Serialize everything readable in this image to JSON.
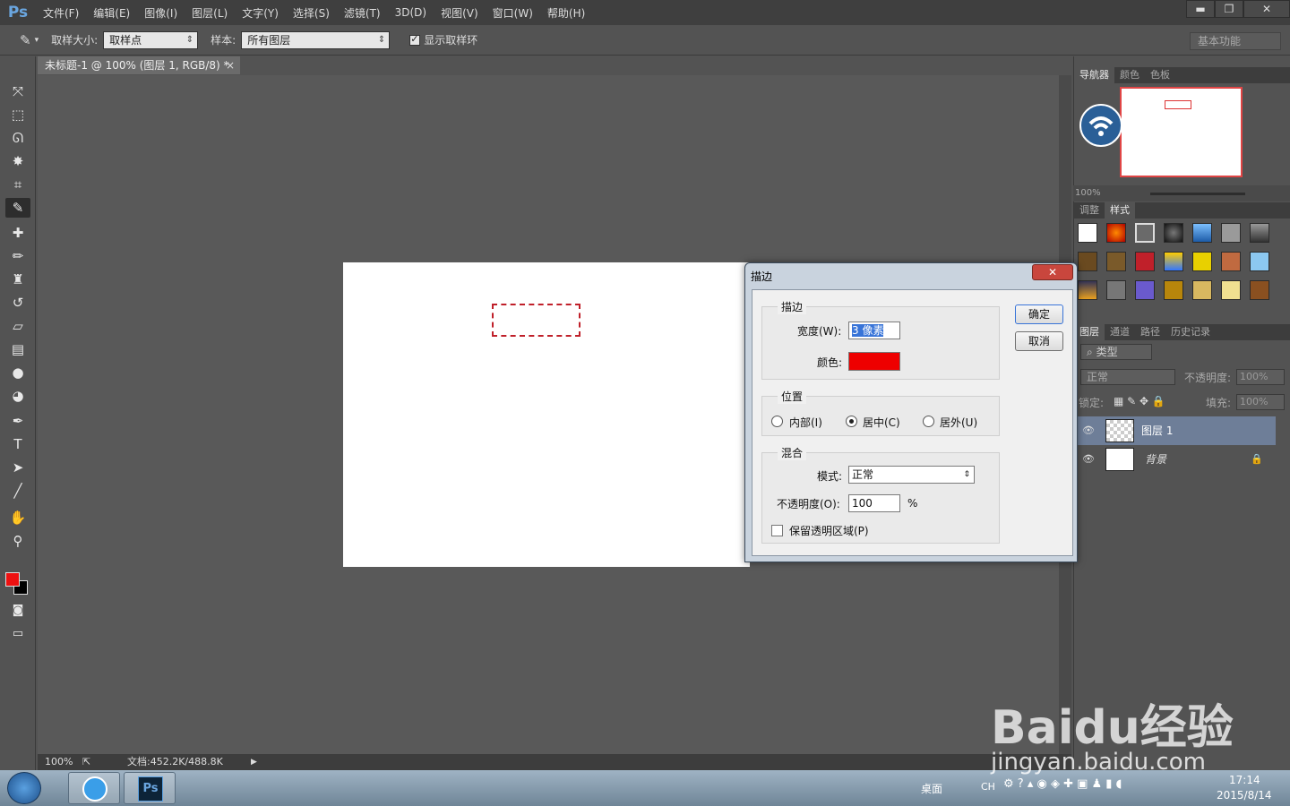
{
  "app": {
    "logo": "Ps"
  },
  "menu": [
    "文件(F)",
    "编辑(E)",
    "图像(I)",
    "图层(L)",
    "文字(Y)",
    "选择(S)",
    "滤镜(T)",
    "3D(D)",
    "视图(V)",
    "窗口(W)",
    "帮助(H)"
  ],
  "window_controls": {
    "minimize": "▬",
    "maximize": "❐",
    "close": "✕"
  },
  "options": {
    "sample_size_label": "取样大小:",
    "sample_size_value": "取样点",
    "sample_label": "样本:",
    "sample_value": "所有图层",
    "show_ring_label": "显示取样环",
    "workspace": "基本功能"
  },
  "document": {
    "tab_title": "未标题-1 @ 100% (图层 1, RGB/8) *",
    "tab_close": "×",
    "zoom": "100%",
    "doc_info": "文档:452.2K/488.8K"
  },
  "panels": {
    "nav_tabs": [
      "导航器",
      "颜色",
      "色板"
    ],
    "nav_zoom": "100%",
    "style_tabs": [
      "调整",
      "样式"
    ],
    "layer_tabs": [
      "图层",
      "通道",
      "路径",
      "历史记录"
    ],
    "filter_kind": "类型",
    "blend_mode": "正常",
    "opacity_label": "不透明度:",
    "opacity_value": "100%",
    "lock_label": "锁定:",
    "fill_label": "填充:",
    "fill_value": "100%",
    "layers": [
      {
        "name": "图层 1",
        "selected": true
      },
      {
        "name": "背景",
        "selected": false
      }
    ]
  },
  "dialog": {
    "title": "描边",
    "close": "✕",
    "stroke_group": "描边",
    "width_label": "宽度(W):",
    "width_value": "3 像素",
    "color_label": "颜色:",
    "stroke_color": "#ee0000",
    "position_group": "位置",
    "pos_inside": "内部(I)",
    "pos_center": "居中(C)",
    "pos_outside": "居外(U)",
    "selected_position": "center",
    "blend_group": "混合",
    "mode_label": "模式:",
    "mode_value": "正常",
    "opacity_label": "不透明度(O):",
    "opacity_value": "100",
    "opacity_unit": "%",
    "preserve_label": "保留透明区域(P)",
    "ok": "确定",
    "cancel": "取消"
  },
  "taskbar": {
    "desktop": "桌面",
    "lang": "CH",
    "time": "17:14",
    "date": "2015/8/14"
  },
  "watermark": {
    "line1": "Baidu经验",
    "line2": "jingyan.baidu.com"
  },
  "colors": {
    "foreground": "#ee1111",
    "background": "#000000"
  }
}
